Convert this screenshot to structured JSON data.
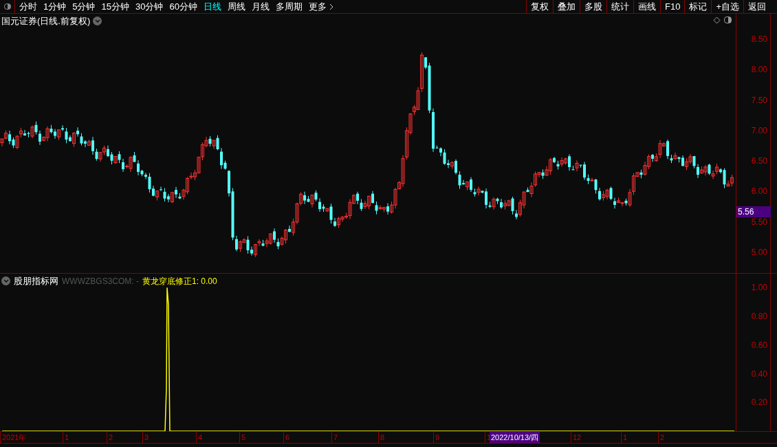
{
  "toolbar": {
    "periods": [
      {
        "label": "分时",
        "selected": false
      },
      {
        "label": "1分钟",
        "selected": false
      },
      {
        "label": "5分钟",
        "selected": false
      },
      {
        "label": "15分钟",
        "selected": false
      },
      {
        "label": "30分钟",
        "selected": false
      },
      {
        "label": "60分钟",
        "selected": false
      },
      {
        "label": "日线",
        "selected": true
      },
      {
        "label": "周线",
        "selected": false
      },
      {
        "label": "月线",
        "selected": false
      },
      {
        "label": "多周期",
        "selected": false
      },
      {
        "label": "更多",
        "selected": false
      }
    ],
    "actions": [
      "复权",
      "叠加",
      "多股",
      "统计",
      "画线",
      "F10",
      "标记",
      "+自选",
      "返回"
    ]
  },
  "price_panel": {
    "title": "国元证券(日线.前复权)",
    "axis_labels": [
      "8.50",
      "8.00",
      "7.50",
      "7.00",
      "6.50",
      "6.00",
      "5.50",
      "5.00"
    ],
    "current_price": "5.56"
  },
  "indicator_panel": {
    "source": "股朋指标网",
    "source_note": "WWWZBGS3COM: -",
    "reading": "黄龙穿底修正1: 0.00",
    "axis_labels": [
      "1.00",
      "0.80",
      "0.60",
      "0.40",
      "0.20"
    ]
  },
  "time_axis": {
    "labels": [
      "2021年",
      "1",
      "2",
      "3",
      "4",
      "5",
      "6",
      "7",
      "8",
      "9",
      "1",
      "12",
      "1",
      "2"
    ],
    "cursor_date": "2022/10/13/四"
  }
}
